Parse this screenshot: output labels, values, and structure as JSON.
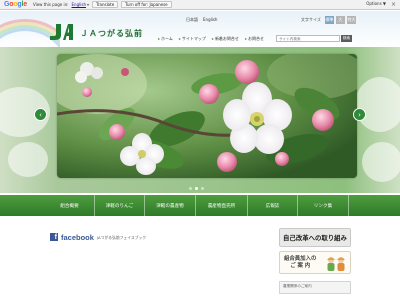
{
  "translate_bar": {
    "logo": "Google",
    "prompt": "View this page in:",
    "language": "English",
    "translate_button": "Translate",
    "turn_off_button": "Turn off for: Japanese",
    "options": "Options ▼",
    "close": "×"
  },
  "header": {
    "brand": "ＪＡつがる弘前",
    "lang_links": [
      "日本語",
      "English"
    ],
    "size_label": "文字サイズ",
    "size_buttons": [
      "標準",
      "大",
      "特大"
    ],
    "top_nav": [
      "ホーム",
      "サイトマップ",
      "新着お問合せ",
      "お問合せ"
    ],
    "search_placeholder": "サイト内検索",
    "search_button": "検索"
  },
  "slideshow": {
    "prev": "‹",
    "next": "›",
    "dot_count": 3,
    "active_dot": 1
  },
  "green_nav": [
    "組合概要",
    "津軽のりんご",
    "津軽の農産物",
    "農産物直売所",
    "広報誌",
    "リンク集"
  ],
  "facebook": {
    "icon_letter": "f",
    "title": "facebook",
    "subtitle": "JAつがる弘前フェイスブック"
  },
  "side": {
    "reform_banner": "自己改革への取り組み",
    "member_line1": "組合員加入の",
    "member_line2": "ご 案 内",
    "pdf_text": "農業関係のご案内"
  },
  "colors": {
    "brand_green": "#2f7a27",
    "facebook_blue": "#3b5998"
  }
}
